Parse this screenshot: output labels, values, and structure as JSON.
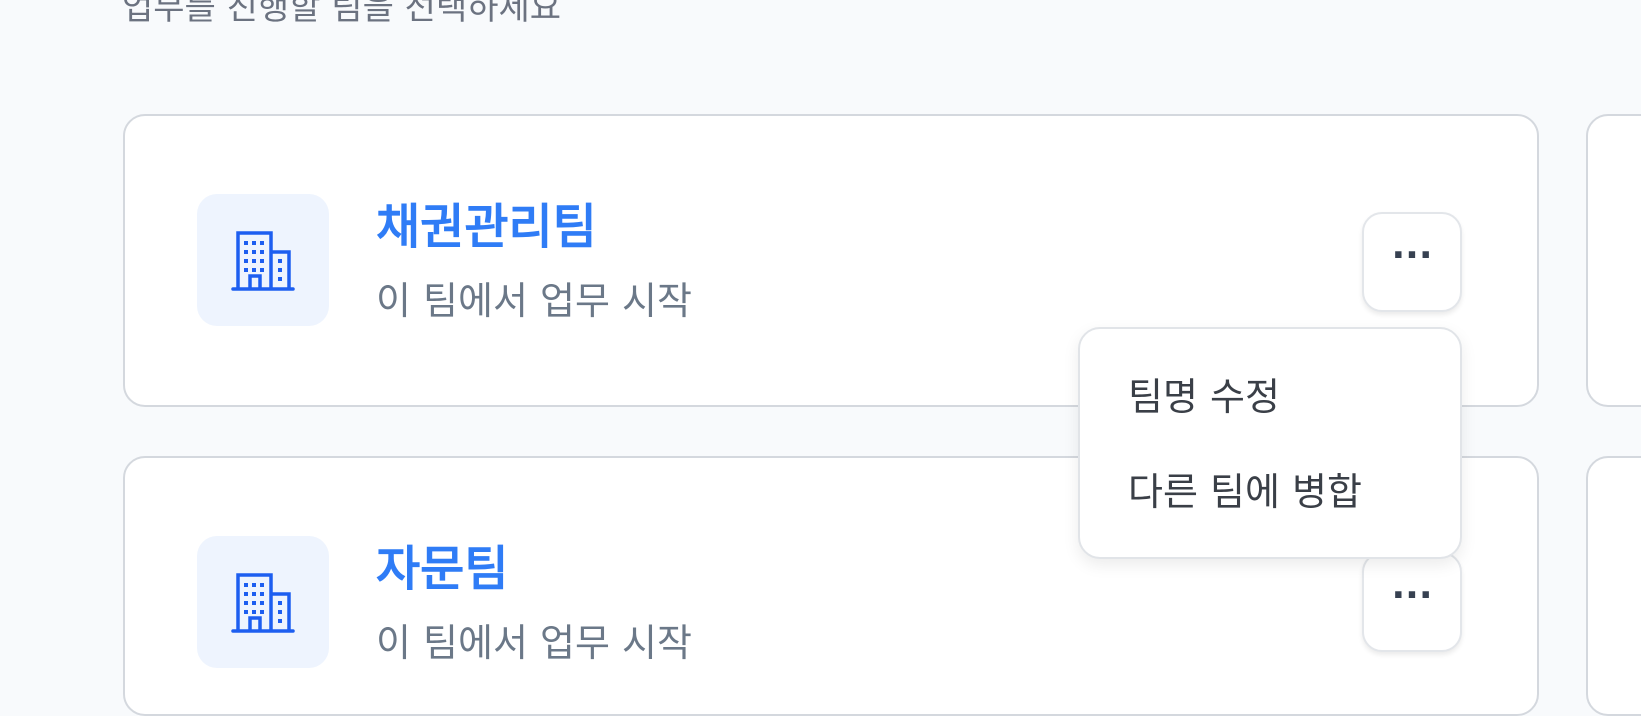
{
  "page": {
    "subtitle": "업무를 진행할 팀을 선택하세요"
  },
  "teams": [
    {
      "name": "채권관리팀",
      "action": "이 팀에서 업무 시작",
      "more_label": "···"
    },
    {
      "name": "자문팀",
      "action": "이 팀에서 업무 시작",
      "more_label": "···"
    }
  ],
  "menu": {
    "items": [
      "팀명 수정",
      "다른 팀에 병합"
    ]
  },
  "colors": {
    "accent": "#2f7cf6",
    "icon_bg": "#eef4fe",
    "icon": "#1d5ef0",
    "page_bg": "#f8fafc"
  },
  "icons": {
    "team": "building-icon",
    "more": "more-horizontal-icon"
  }
}
